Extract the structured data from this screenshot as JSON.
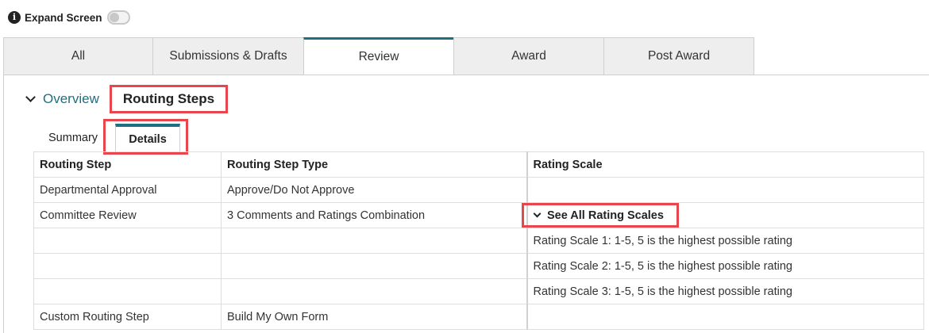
{
  "top": {
    "info_icon": "info-icon",
    "expand_label": "Expand Screen",
    "expand_toggle_on": false
  },
  "tabs": [
    {
      "label": "All",
      "active": false
    },
    {
      "label": "Submissions & Drafts",
      "active": false
    },
    {
      "label": "Review",
      "active": true
    },
    {
      "label": "Award",
      "active": false
    },
    {
      "label": "Post Award",
      "active": false
    }
  ],
  "section": {
    "overview_label": "Overview",
    "title": "Routing Steps"
  },
  "subtabs": {
    "summary": "Summary",
    "details": "Details",
    "active": "Details"
  },
  "table": {
    "headers": [
      "Routing Step",
      "Routing Step Type",
      "Rating Scale"
    ],
    "rows": [
      [
        "Departmental Approval",
        "Approve/Do Not Approve",
        ""
      ],
      [
        "Committee Review",
        "3 Comments and Ratings Combination",
        ""
      ],
      [
        "",
        "",
        "Rating Scale 1: 1-5, 5 is the highest possible rating"
      ],
      [
        "",
        "",
        "Rating Scale 2: 1-5, 5 is the highest possible rating"
      ],
      [
        "",
        "",
        "Rating Scale 3: 1-5, 5 is the highest possible rating"
      ],
      [
        "Custom Routing Step",
        "Build My Own Form",
        ""
      ]
    ],
    "see_all_label": "See All Rating Scales"
  },
  "colors": {
    "accent": "#1e6f82",
    "highlight": "#e8454c",
    "tab_bg": "#eeeeee"
  }
}
